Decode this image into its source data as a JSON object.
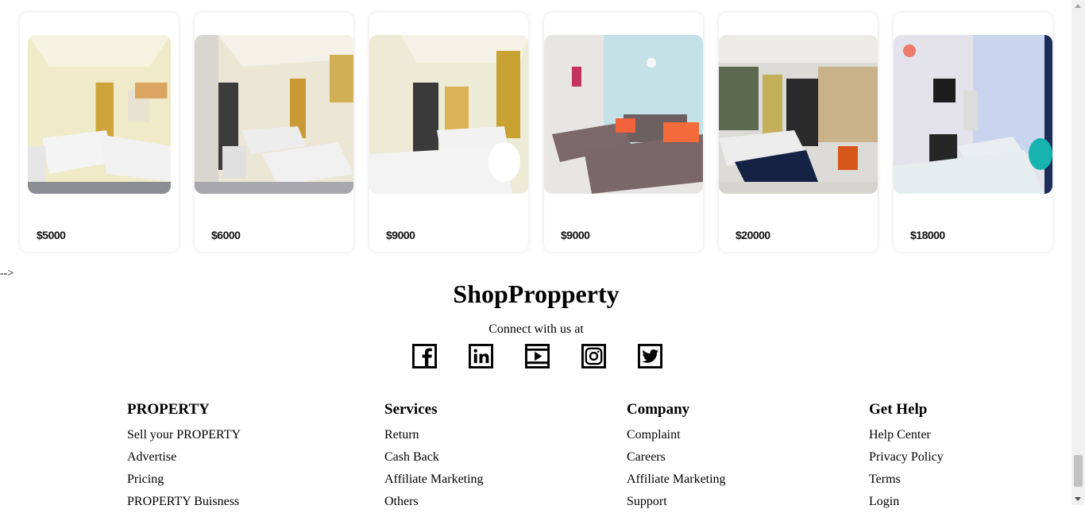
{
  "listings": [
    {
      "price": "$5000"
    },
    {
      "price": "$6000"
    },
    {
      "price": "$9000"
    },
    {
      "price": "$9000"
    },
    {
      "price": "$20000"
    },
    {
      "price": "$18000"
    }
  ],
  "stray_text": "-->",
  "footer": {
    "brand": "ShopPropperty",
    "connect": "Connect with us at",
    "socials": [
      "facebook-icon",
      "linkedin-icon",
      "youtube-icon",
      "instagram-icon",
      "twitter-icon"
    ],
    "columns": [
      {
        "title": "PROPERTY",
        "links": [
          "Sell your PROPERTY",
          "Advertise",
          "Pricing",
          "PROPERTY Buisness"
        ]
      },
      {
        "title": "Services",
        "links": [
          "Return",
          "Cash Back",
          "Affiliate Marketing",
          "Others"
        ]
      },
      {
        "title": "Company",
        "links": [
          "Complaint",
          "Careers",
          "Affiliate Marketing",
          "Support"
        ]
      },
      {
        "title": "Get Help",
        "links": [
          "Help Center",
          "Privacy Policy",
          "Terms",
          "Login"
        ]
      }
    ]
  }
}
